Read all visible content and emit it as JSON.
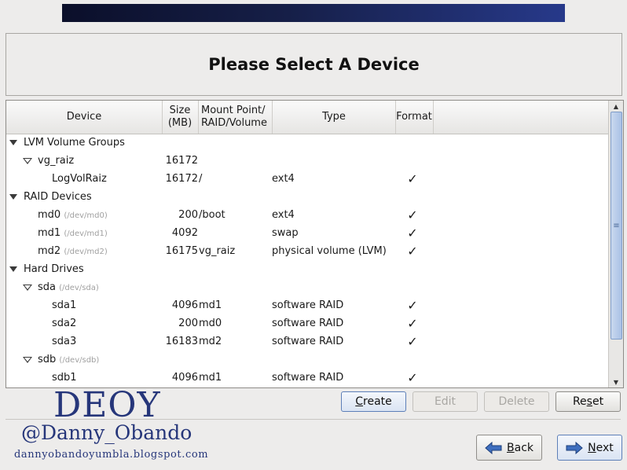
{
  "header": {
    "title": "Please Select A Device"
  },
  "table": {
    "columns": {
      "device": "Device",
      "size": "Size\n(MB)",
      "mount": "Mount Point/\nRAID/Volume",
      "type": "Type",
      "format": "Format"
    },
    "rows": [
      {
        "name": "LVM Volume Groups",
        "dev": "",
        "size": "",
        "mount": "",
        "type": "",
        "format": ""
      },
      {
        "name": "vg_raiz",
        "dev": "",
        "size": "16172",
        "mount": "",
        "type": "",
        "format": ""
      },
      {
        "name": "LogVolRaiz",
        "dev": "",
        "size": "16172",
        "mount": "/",
        "type": "ext4",
        "format": "✓"
      },
      {
        "name": "RAID Devices",
        "dev": "",
        "size": "",
        "mount": "",
        "type": "",
        "format": ""
      },
      {
        "name": "md0",
        "dev": "(/dev/md0)",
        "size": "200",
        "mount": "/boot",
        "type": "ext4",
        "format": "✓"
      },
      {
        "name": "md1",
        "dev": "(/dev/md1)",
        "size": "4092",
        "mount": "",
        "type": "swap",
        "format": "✓"
      },
      {
        "name": "md2",
        "dev": "(/dev/md2)",
        "size": "16175",
        "mount": "vg_raiz",
        "type": "physical volume (LVM)",
        "format": "✓"
      },
      {
        "name": "Hard Drives",
        "dev": "",
        "size": "",
        "mount": "",
        "type": "",
        "format": ""
      },
      {
        "name": "sda",
        "dev": "(/dev/sda)",
        "size": "",
        "mount": "",
        "type": "",
        "format": ""
      },
      {
        "name": "sda1",
        "dev": "",
        "size": "4096",
        "mount": "md1",
        "type": "software RAID",
        "format": "✓"
      },
      {
        "name": "sda2",
        "dev": "",
        "size": "200",
        "mount": "md0",
        "type": "software RAID",
        "format": "✓"
      },
      {
        "name": "sda3",
        "dev": "",
        "size": "16183",
        "mount": "md2",
        "type": "software RAID",
        "format": "✓"
      },
      {
        "name": "sdb",
        "dev": "(/dev/sdb)",
        "size": "",
        "mount": "",
        "type": "",
        "format": ""
      },
      {
        "name": "sdb1",
        "dev": "",
        "size": "4096",
        "mount": "md1",
        "type": "software RAID",
        "format": "✓"
      }
    ]
  },
  "actions": {
    "create": {
      "key": "C",
      "rest": "reate"
    },
    "edit": "Edit",
    "delete": "Delete",
    "reset": {
      "pre": "Re",
      "key": "s",
      "rest": "et"
    }
  },
  "nav": {
    "back": {
      "key": "B",
      "rest": "ack"
    },
    "next": {
      "key": "N",
      "rest": "ext"
    }
  },
  "watermark": {
    "logo": "DEOY",
    "handle": "@Danny_Obando",
    "blog": "dannyobandoyumbla.blogspot.com"
  },
  "icons": {
    "expander": "triangle-down-icon",
    "check": "checkmark-icon",
    "back": "arrow-left-icon",
    "next": "arrow-right-icon"
  },
  "colors": {
    "banner": "#161f48",
    "nav_arrow": "#3f6fbf",
    "watermark": "#26367a"
  }
}
